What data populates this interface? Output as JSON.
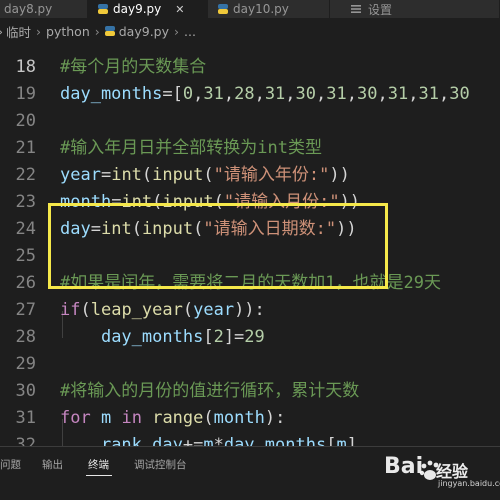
{
  "tabs": [
    {
      "label": "day8.py"
    },
    {
      "label": "day9.py",
      "active": true
    },
    {
      "label": "day10.py"
    },
    {
      "label": "设置"
    }
  ],
  "breadcrumb": [
    "临时",
    "python",
    "day9.py",
    "..."
  ],
  "code_lines": [
    {
      "no": "18",
      "tokens": [
        {
          "t": "#每个月的天数集合",
          "c": "comment"
        }
      ]
    },
    {
      "no": "19",
      "tokens": [
        {
          "t": "day_months",
          "c": "var"
        },
        {
          "t": "=[",
          "c": "op"
        },
        {
          "t": "0",
          "c": "num"
        },
        {
          "t": ",",
          "c": "op"
        },
        {
          "t": "31",
          "c": "num"
        },
        {
          "t": ",",
          "c": "op"
        },
        {
          "t": "28",
          "c": "num"
        },
        {
          "t": ",",
          "c": "op"
        },
        {
          "t": "31",
          "c": "num"
        },
        {
          "t": ",",
          "c": "op"
        },
        {
          "t": "30",
          "c": "num"
        },
        {
          "t": ",",
          "c": "op"
        },
        {
          "t": "31",
          "c": "num"
        },
        {
          "t": ",",
          "c": "op"
        },
        {
          "t": "30",
          "c": "num"
        },
        {
          "t": ",",
          "c": "op"
        },
        {
          "t": "31",
          "c": "num"
        },
        {
          "t": ",",
          "c": "op"
        },
        {
          "t": "31",
          "c": "num"
        },
        {
          "t": ",",
          "c": "op"
        },
        {
          "t": "30",
          "c": "num"
        }
      ]
    },
    {
      "no": "20",
      "tokens": []
    },
    {
      "no": "21",
      "tokens": [
        {
          "t": "#输入年月日并全部转换为int类型",
          "c": "comment"
        }
      ]
    },
    {
      "no": "22",
      "tokens": [
        {
          "t": "year",
          "c": "var"
        },
        {
          "t": "=",
          "c": "op"
        },
        {
          "t": "int",
          "c": "func"
        },
        {
          "t": "(",
          "c": "op"
        },
        {
          "t": "input",
          "c": "func"
        },
        {
          "t": "(",
          "c": "op"
        },
        {
          "t": "\"请输入年份:\"",
          "c": "str"
        },
        {
          "t": "))",
          "c": "op"
        }
      ]
    },
    {
      "no": "23",
      "tokens": [
        {
          "t": "month",
          "c": "var"
        },
        {
          "t": "=",
          "c": "op"
        },
        {
          "t": "int",
          "c": "func"
        },
        {
          "t": "(",
          "c": "op"
        },
        {
          "t": "input",
          "c": "func"
        },
        {
          "t": "(",
          "c": "op"
        },
        {
          "t": "\"请输入月份:\"",
          "c": "str"
        },
        {
          "t": "))",
          "c": "op"
        }
      ]
    },
    {
      "no": "24",
      "tokens": [
        {
          "t": "day",
          "c": "var"
        },
        {
          "t": "=",
          "c": "op"
        },
        {
          "t": "int",
          "c": "func"
        },
        {
          "t": "(",
          "c": "op"
        },
        {
          "t": "input",
          "c": "func"
        },
        {
          "t": "(",
          "c": "op"
        },
        {
          "t": "\"请输入日期数:\"",
          "c": "str"
        },
        {
          "t": "))",
          "c": "op"
        }
      ]
    },
    {
      "no": "25",
      "tokens": []
    },
    {
      "no": "26",
      "tokens": [
        {
          "t": "#如果是闰年，需要将二月的天数加1，也就是29天",
          "c": "comment"
        }
      ]
    },
    {
      "no": "27",
      "tokens": [
        {
          "t": "if",
          "c": "kw"
        },
        {
          "t": "(",
          "c": "op"
        },
        {
          "t": "leap_year",
          "c": "func"
        },
        {
          "t": "(",
          "c": "op"
        },
        {
          "t": "year",
          "c": "var"
        },
        {
          "t": ")):",
          "c": "op"
        }
      ]
    },
    {
      "no": "28",
      "tokens": [
        {
          "t": "    ",
          "c": "op"
        },
        {
          "t": "day_months",
          "c": "var"
        },
        {
          "t": "[",
          "c": "op"
        },
        {
          "t": "2",
          "c": "num"
        },
        {
          "t": "]=",
          "c": "op"
        },
        {
          "t": "29",
          "c": "num"
        }
      ]
    },
    {
      "no": "29",
      "tokens": []
    },
    {
      "no": "30",
      "tokens": [
        {
          "t": "#将输入的月份的值进行循环，累计天数",
          "c": "comment"
        }
      ]
    },
    {
      "no": "31",
      "tokens": [
        {
          "t": "for",
          "c": "kw"
        },
        {
          "t": " ",
          "c": "op"
        },
        {
          "t": "m",
          "c": "var"
        },
        {
          "t": " ",
          "c": "op"
        },
        {
          "t": "in",
          "c": "kw"
        },
        {
          "t": " ",
          "c": "op"
        },
        {
          "t": "range",
          "c": "func"
        },
        {
          "t": "(",
          "c": "op"
        },
        {
          "t": "month",
          "c": "var"
        },
        {
          "t": "):",
          "c": "op"
        }
      ]
    },
    {
      "no": "32",
      "tokens": [
        {
          "t": "    ",
          "c": "op"
        },
        {
          "t": "rank_day",
          "c": "var"
        },
        {
          "t": "+=",
          "c": "op"
        },
        {
          "t": "m",
          "c": "var"
        },
        {
          "t": "*",
          "c": "op"
        },
        {
          "t": "day_months",
          "c": "var"
        },
        {
          "t": "[",
          "c": "op"
        },
        {
          "t": "m",
          "c": "var"
        },
        {
          "t": "]",
          "c": "op"
        }
      ]
    }
  ],
  "panel_tabs": [
    {
      "label": "问题"
    },
    {
      "label": "输出"
    },
    {
      "label": "终端",
      "active": true
    },
    {
      "label": "调试控制台"
    }
  ],
  "watermark": {
    "text": "Bai",
    "cn": "经验",
    "url": "jingyan.baidu.com"
  },
  "colors": {
    "editor_bg": "#1e1e1e",
    "highlight": "#f5e84a",
    "comment": "#6a9955",
    "string": "#ce9178"
  }
}
